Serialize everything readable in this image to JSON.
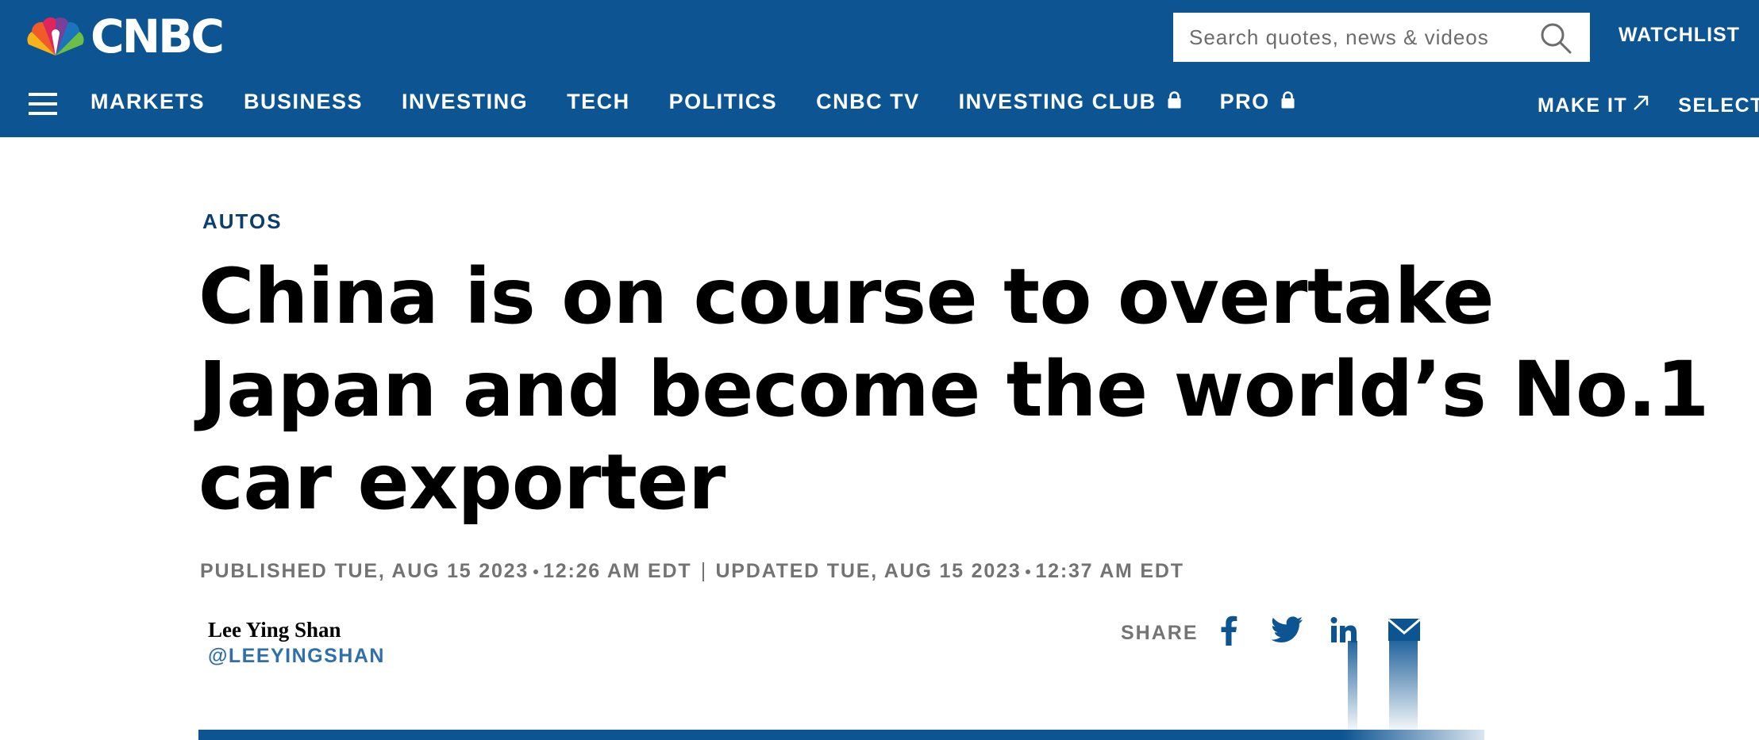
{
  "header": {
    "logo_text": "CNBC",
    "search": {
      "placeholder": "Search quotes, news & videos"
    },
    "watchlist_label": "WATCHLIST",
    "nav": [
      {
        "label": "MARKETS",
        "locked": false
      },
      {
        "label": "BUSINESS",
        "locked": false
      },
      {
        "label": "INVESTING",
        "locked": false
      },
      {
        "label": "TECH",
        "locked": false
      },
      {
        "label": "POLITICS",
        "locked": false
      },
      {
        "label": "CNBC TV",
        "locked": false
      },
      {
        "label": "INVESTING CLUB",
        "locked": true
      },
      {
        "label": "PRO",
        "locked": true
      }
    ],
    "nav_right": [
      {
        "label": "MAKE IT",
        "external": true
      },
      {
        "label": "SELECT",
        "external": false
      }
    ]
  },
  "article": {
    "kicker": "AUTOS",
    "headline": "China is on course to overtake Japan and become the world’s No.1 car exporter",
    "published_label": "PUBLISHED",
    "published": "TUE, AUG 15 2023",
    "published_time": "12:26 AM EDT",
    "updated_label": "UPDATED",
    "updated": "TUE, AUG 15 2023",
    "updated_time": "12:37 AM EDT",
    "author": {
      "name": "Lee Ying Shan",
      "handle": "@LEEYINGSHAN"
    },
    "share_label": "SHARE"
  },
  "colors": {
    "brand_blue": "#0c5492",
    "kicker_blue": "#0c3e6e",
    "handle_blue": "#2f6faa",
    "meta_gray": "#737373"
  }
}
